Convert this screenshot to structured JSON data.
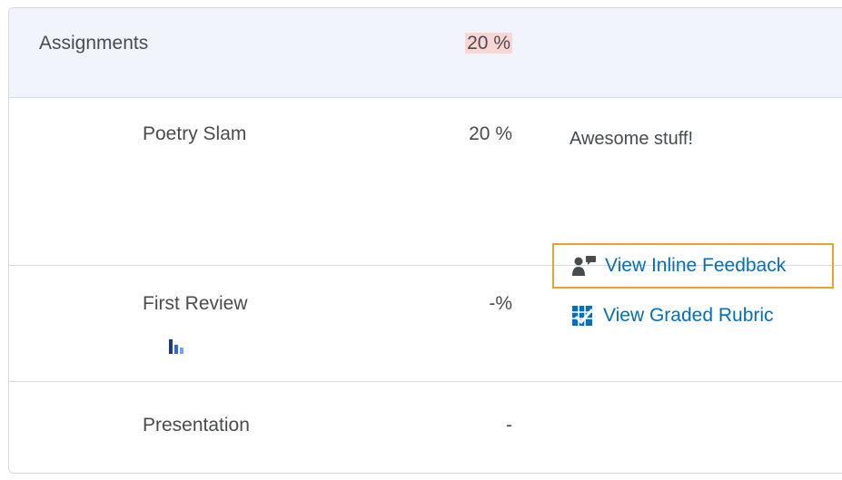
{
  "category": {
    "name": "Assignments",
    "grade": "20 %"
  },
  "items": [
    {
      "name": "Poetry Slam",
      "grade": "20 %",
      "feedback": "Awesome stuff!",
      "links": {
        "inline_feedback": "View Inline Feedback",
        "graded_rubric": "View Graded Rubric"
      }
    },
    {
      "name": "First Review",
      "grade": "-%"
    },
    {
      "name": "Presentation",
      "grade": "-"
    }
  ],
  "icons": {
    "inline_feedback": "feedback-person-icon",
    "rubric": "rubric-icon",
    "stats": "bar-chart-icon"
  },
  "colors": {
    "link": "#006fbf",
    "highlight_border": "#e7a32e",
    "category_bg": "#f1f5fb",
    "grade_highlight": "#f9d6d6"
  }
}
